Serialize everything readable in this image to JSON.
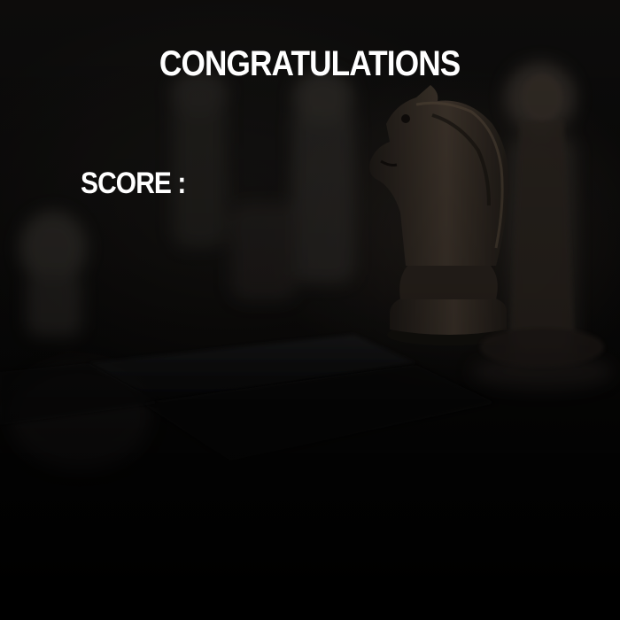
{
  "title": "CONGRATULATIONS",
  "score": {
    "label": "SCORE :",
    "value": ""
  },
  "background": {
    "image": "chess-pieces-photo",
    "overlay_color": "#000000"
  }
}
